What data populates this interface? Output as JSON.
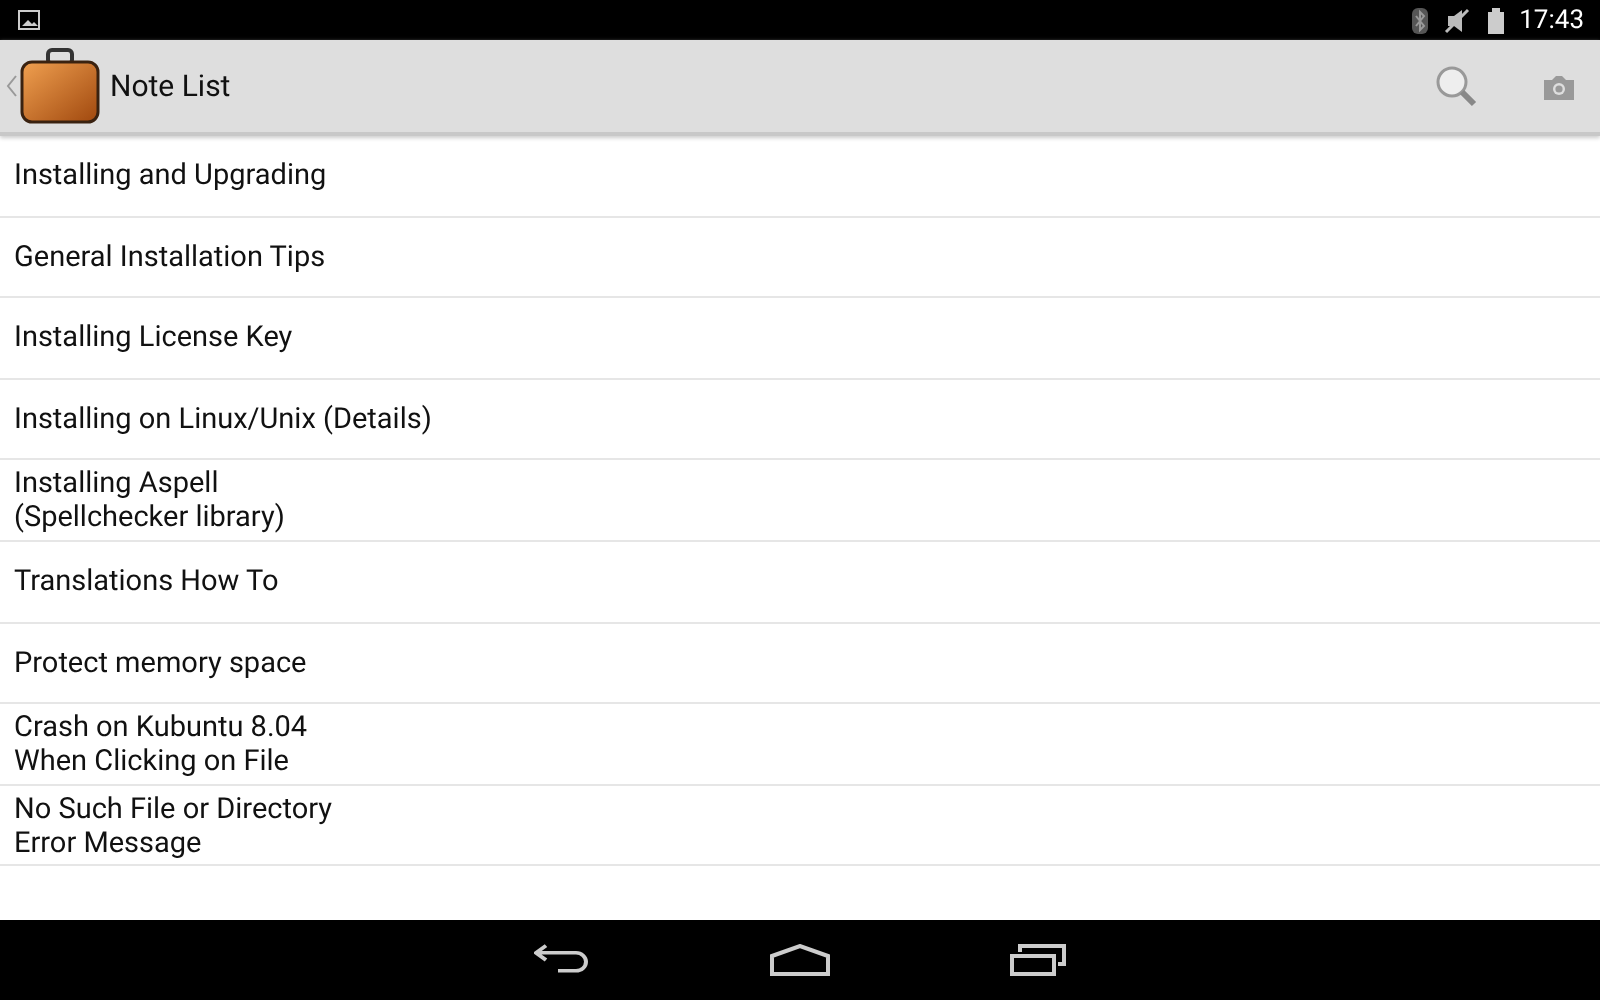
{
  "status_bar": {
    "time": "17:43"
  },
  "action_bar": {
    "title": "Note List"
  },
  "notes": [
    {
      "lines": [
        "Installing and Upgrading"
      ]
    },
    {
      "lines": [
        "General Installation Tips"
      ]
    },
    {
      "lines": [
        "Installing License Key"
      ]
    },
    {
      "lines": [
        "Installing on Linux/Unix (Details)"
      ]
    },
    {
      "lines": [
        "Installing Aspell",
        "(Spellchecker library)"
      ]
    },
    {
      "lines": [
        "Translations How To"
      ]
    },
    {
      "lines": [
        "Protect memory space"
      ]
    },
    {
      "lines": [
        "Crash on Kubuntu 8.04",
        "When Clicking on File"
      ]
    },
    {
      "lines": [
        "No Such File or Directory",
        "Error Message"
      ]
    }
  ]
}
